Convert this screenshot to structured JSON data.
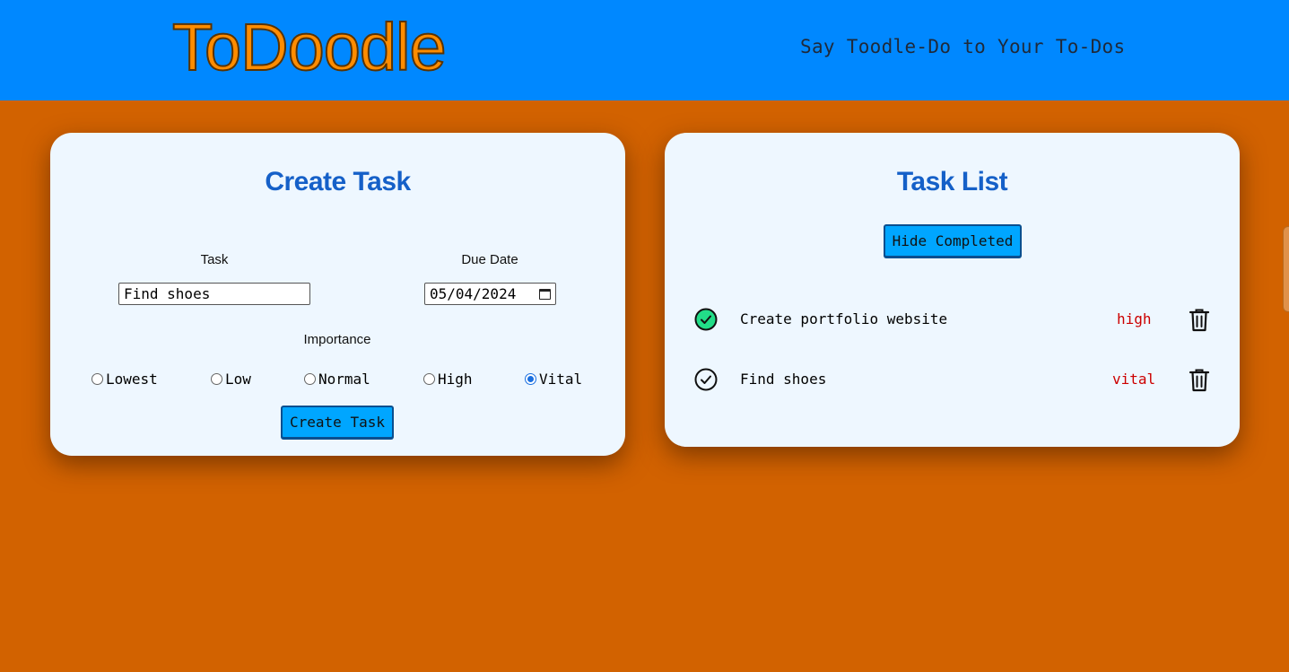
{
  "header": {
    "logo": "ToDoodle",
    "tagline": "Say Toodle-Do to Your To-Dos"
  },
  "create": {
    "title": "Create Task",
    "task_label": "Task",
    "task_value": "Find shoes",
    "due_label": "Due Date",
    "due_value": "05/04/2024",
    "importance_label": "Importance",
    "options": [
      "Lowest",
      "Low",
      "Normal",
      "High",
      "Vital"
    ],
    "selected": "Vital",
    "submit_label": "Create Task"
  },
  "list": {
    "title": "Task List",
    "hide_label": "Hide Completed",
    "tasks": [
      {
        "name": "Create portfolio website",
        "importance": "high",
        "completed": true
      },
      {
        "name": "Find shoes",
        "importance": "vital",
        "completed": false
      }
    ]
  },
  "colors": {
    "header_bg": "#0088ff",
    "page_bg": "#d26200",
    "card_bg": "#eef7ff",
    "title": "#1560c8",
    "button": "#00a6ff",
    "importance": "#cc0000",
    "completed_check": "#22dd88"
  }
}
